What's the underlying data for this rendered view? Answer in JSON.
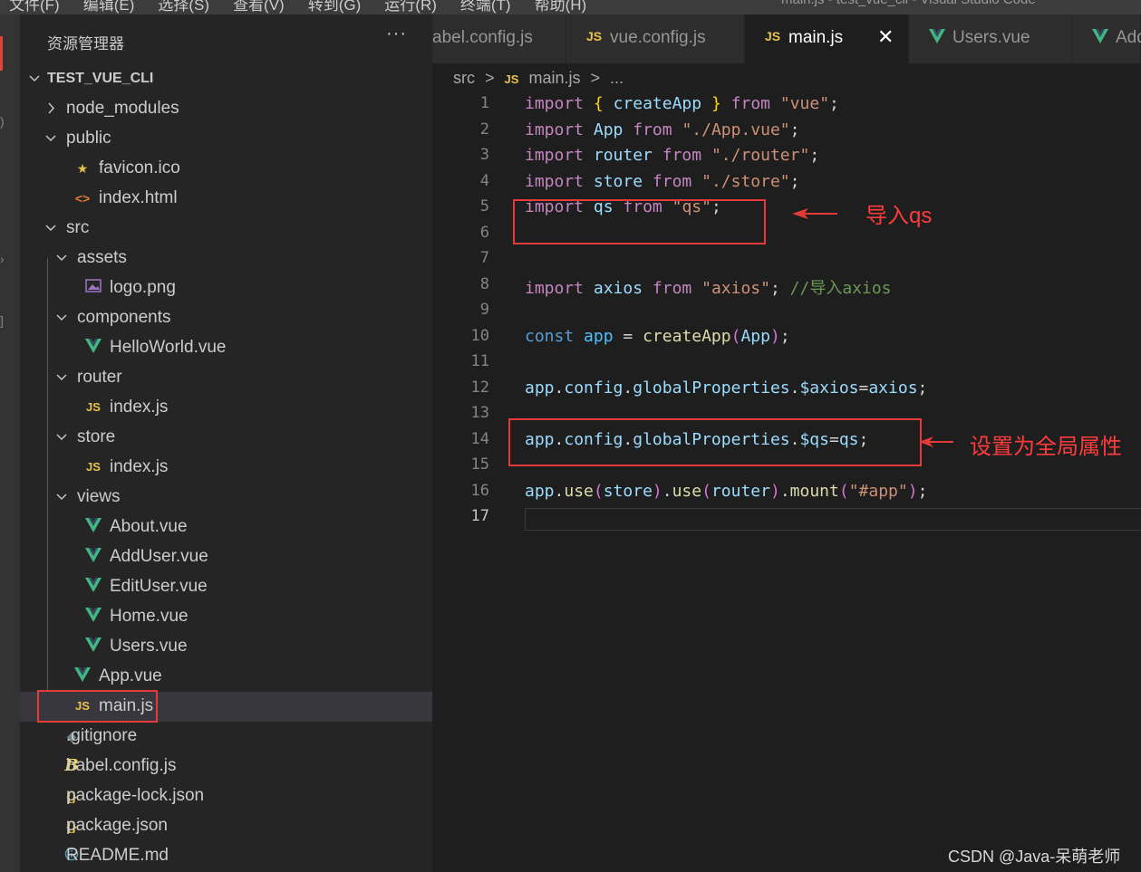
{
  "menubar": {
    "items": [
      "文件(F)",
      "编辑(E)",
      "选择(S)",
      "查看(V)",
      "转到(G)",
      "运行(R)",
      "终端(T)",
      "帮助(H)"
    ],
    "window_title": "main.js - test_vue_cli - Visual Studio Code"
  },
  "sidebar": {
    "title": "资源管理器",
    "more": "···",
    "root": "TEST_VUE_CLI",
    "items": [
      {
        "label": "node_modules",
        "type": "folder",
        "expanded": false
      },
      {
        "label": "public",
        "type": "folder",
        "expanded": true
      },
      {
        "label": "favicon.ico",
        "type": "ico"
      },
      {
        "label": "index.html",
        "type": "html"
      },
      {
        "label": "src",
        "type": "folder",
        "expanded": true
      },
      {
        "label": "assets",
        "type": "folder",
        "expanded": true
      },
      {
        "label": "logo.png",
        "type": "image"
      },
      {
        "label": "components",
        "type": "folder",
        "expanded": true
      },
      {
        "label": "HelloWorld.vue",
        "type": "vue"
      },
      {
        "label": "router",
        "type": "folder",
        "expanded": true
      },
      {
        "label": "index.js",
        "type": "js"
      },
      {
        "label": "store",
        "type": "folder",
        "expanded": true
      },
      {
        "label": "index.js",
        "type": "js"
      },
      {
        "label": "views",
        "type": "folder",
        "expanded": true
      },
      {
        "label": "About.vue",
        "type": "vue"
      },
      {
        "label": "AddUser.vue",
        "type": "vue"
      },
      {
        "label": "EditUser.vue",
        "type": "vue"
      },
      {
        "label": "Home.vue",
        "type": "vue"
      },
      {
        "label": "Users.vue",
        "type": "vue"
      },
      {
        "label": "App.vue",
        "type": "vue"
      },
      {
        "label": "main.js",
        "type": "js"
      },
      {
        "label": ".gitignore",
        "type": "git"
      },
      {
        "label": "babel.config.js",
        "type": "babel"
      },
      {
        "label": "package-lock.json",
        "type": "json"
      },
      {
        "label": "package.json",
        "type": "json"
      },
      {
        "label": "README.md",
        "type": "info"
      }
    ]
  },
  "tabs": [
    {
      "label": "abel.config.js",
      "icon": "babel"
    },
    {
      "label": "vue.config.js",
      "icon": "js"
    },
    {
      "label": "main.js",
      "icon": "js",
      "active": true
    },
    {
      "label": "Users.vue",
      "icon": "vue"
    },
    {
      "label": "Add",
      "icon": "vue"
    }
  ],
  "tab_close": "✕",
  "icons": {
    "js": "JS",
    "vue": "V",
    "babel": "B",
    "json": "{}",
    "html": "<>",
    "ico": "★",
    "git": "◆",
    "info": "ⓘ"
  },
  "breadcrumb": {
    "folder": "src",
    "sep": ">",
    "icon": "JS",
    "file": "main.js",
    "more": "..."
  },
  "editor": {
    "current_line": 17,
    "lines": [
      [
        [
          "kw",
          "import"
        ],
        [
          "punc",
          " "
        ],
        [
          "brace",
          "{"
        ],
        [
          "punc",
          " "
        ],
        [
          "var",
          "createApp"
        ],
        [
          "punc",
          " "
        ],
        [
          "brace",
          "}"
        ],
        [
          "punc",
          " "
        ],
        [
          "kw",
          "from"
        ],
        [
          "punc",
          " "
        ],
        [
          "str",
          "\"vue\""
        ],
        [
          "punc",
          ";"
        ]
      ],
      [
        [
          "kw",
          "import"
        ],
        [
          "punc",
          " "
        ],
        [
          "var",
          "App"
        ],
        [
          "punc",
          " "
        ],
        [
          "kw",
          "from"
        ],
        [
          "punc",
          " "
        ],
        [
          "str",
          "\"./App.vue\""
        ],
        [
          "punc",
          ";"
        ]
      ],
      [
        [
          "kw",
          "import"
        ],
        [
          "punc",
          " "
        ],
        [
          "var",
          "router"
        ],
        [
          "punc",
          " "
        ],
        [
          "kw",
          "from"
        ],
        [
          "punc",
          " "
        ],
        [
          "str",
          "\"./router\""
        ],
        [
          "punc",
          ";"
        ]
      ],
      [
        [
          "kw",
          "import"
        ],
        [
          "punc",
          " "
        ],
        [
          "var",
          "store"
        ],
        [
          "punc",
          " "
        ],
        [
          "kw",
          "from"
        ],
        [
          "punc",
          " "
        ],
        [
          "str",
          "\"./store\""
        ],
        [
          "punc",
          ";"
        ]
      ],
      [
        [
          "kw",
          "import"
        ],
        [
          "punc",
          " "
        ],
        [
          "var",
          "qs"
        ],
        [
          "punc",
          " "
        ],
        [
          "kw",
          "from"
        ],
        [
          "punc",
          " "
        ],
        [
          "str",
          "\"qs\""
        ],
        [
          "punc",
          ";"
        ]
      ],
      [],
      [],
      [
        [
          "kw",
          "import"
        ],
        [
          "punc",
          " "
        ],
        [
          "var",
          "axios"
        ],
        [
          "punc",
          " "
        ],
        [
          "kw",
          "from"
        ],
        [
          "punc",
          " "
        ],
        [
          "str",
          "\"axios\""
        ],
        [
          "punc",
          "; "
        ],
        [
          "cmt",
          "//导入axios"
        ]
      ],
      [],
      [
        [
          "decl",
          "const"
        ],
        [
          "punc",
          " "
        ],
        [
          "const",
          "app"
        ],
        [
          "punc",
          " = "
        ],
        [
          "fn",
          "createApp"
        ],
        [
          "paren",
          "("
        ],
        [
          "var",
          "App"
        ],
        [
          "paren",
          ")"
        ],
        [
          "punc",
          ";"
        ]
      ],
      [],
      [
        [
          "var",
          "app"
        ],
        [
          "punc",
          "."
        ],
        [
          "var",
          "config"
        ],
        [
          "punc",
          "."
        ],
        [
          "var",
          "globalProperties"
        ],
        [
          "punc",
          "."
        ],
        [
          "var",
          "$axios"
        ],
        [
          "punc",
          "="
        ],
        [
          "var",
          "axios"
        ],
        [
          "punc",
          ";"
        ]
      ],
      [],
      [
        [
          "var",
          "app"
        ],
        [
          "punc",
          "."
        ],
        [
          "var",
          "config"
        ],
        [
          "punc",
          "."
        ],
        [
          "var",
          "globalProperties"
        ],
        [
          "punc",
          "."
        ],
        [
          "var",
          "$qs"
        ],
        [
          "punc",
          "="
        ],
        [
          "var",
          "qs"
        ],
        [
          "punc",
          ";"
        ]
      ],
      [],
      [
        [
          "var",
          "app"
        ],
        [
          "punc",
          "."
        ],
        [
          "fn",
          "use"
        ],
        [
          "paren",
          "("
        ],
        [
          "var",
          "store"
        ],
        [
          "paren",
          ")"
        ],
        [
          "punc",
          "."
        ],
        [
          "fn",
          "use"
        ],
        [
          "paren",
          "("
        ],
        [
          "var",
          "router"
        ],
        [
          "paren",
          ")"
        ],
        [
          "punc",
          "."
        ],
        [
          "fn",
          "mount"
        ],
        [
          "paren",
          "("
        ],
        [
          "str",
          "\"#app\""
        ],
        [
          "paren",
          ")"
        ],
        [
          "punc",
          ";"
        ]
      ],
      []
    ]
  },
  "annotations": {
    "import_qs": "导入qs",
    "global_prop": "设置为全局属性"
  },
  "watermark": "CSDN @Java-呆萌老师",
  "colors": {
    "annotation_red": "#e43a3a",
    "vue_green": "#41b883",
    "js_yellow": "#e8c14a"
  }
}
